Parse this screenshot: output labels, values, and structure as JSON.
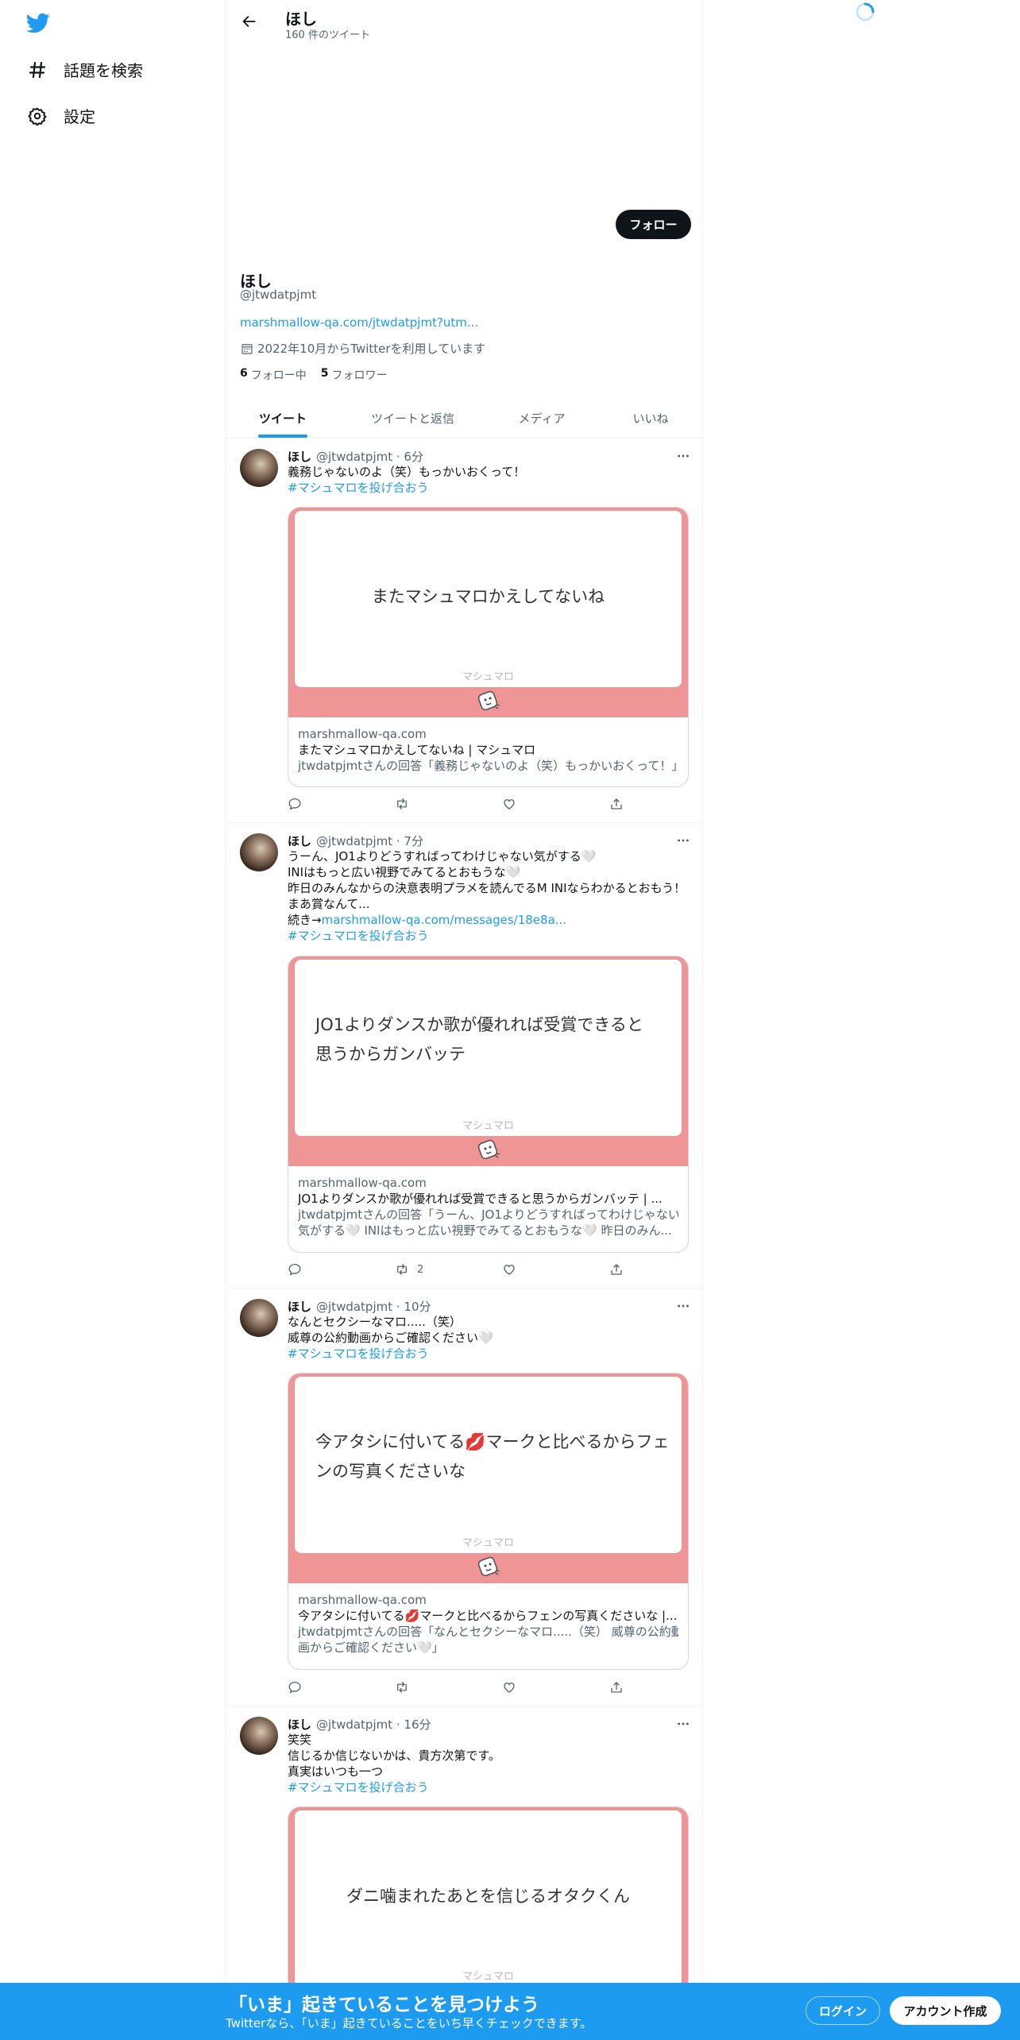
{
  "nav": {
    "items": [
      {
        "label": "話題を検索",
        "icon": "hashtag-icon"
      },
      {
        "label": "設定",
        "icon": "gear-icon"
      }
    ]
  },
  "header": {
    "name": "ほし",
    "tweet_count": "160 件のツイート"
  },
  "profile": {
    "follow_label": "フォロー",
    "name": "ほし",
    "handle": "@jtwdatpjmt",
    "link": "marshmallow-qa.com/jtwdatpjmt?utm...",
    "joined": "2022年10月からTwitterを利用しています",
    "following_count": "6",
    "following_label": "フォロー中",
    "followers_count": "5",
    "followers_label": "フォロワー"
  },
  "tabs": [
    {
      "label": "ツイート",
      "active": true
    },
    {
      "label": "ツイートと返信",
      "active": false
    },
    {
      "label": "メディア",
      "active": false
    },
    {
      "label": "いいね",
      "active": false
    }
  ],
  "tweets": [
    {
      "name": "ほし",
      "meta": "@jtwdatpjmt · 6分",
      "lines": [
        "義務じゃないのよ（笑）もっかいおくって！"
      ],
      "hashtag": "#マシュマロを投げ合おう",
      "card": {
        "question": "またマシュマロかえしてないね",
        "brand": "マシュマロ",
        "domain": "marshmallow-qa.com",
        "title": "またマシュマロかえしてないね | マシュマロ",
        "desc_lines": [
          "jtwdatpjmtさんの回答「義務じゃないのよ（笑）もっかいおくって！」"
        ]
      },
      "retweets": ""
    },
    {
      "name": "ほし",
      "meta": "@jtwdatpjmt · 7分",
      "lines": [
        "うーん、JO1よりどうすればってわけじゃない気がする🤍",
        "INIはもっと広い視野でみてるとおもうな🤍",
        "昨日のみんなからの決意表明プラメを読んでるM INIならわかるとおもう！",
        "まあ賞なんて..."
      ],
      "more_prefix": "続き→",
      "more_link": "marshmallow-qa.com/messages/18e8a...",
      "hashtag": "#マシュマロを投げ合おう",
      "card": {
        "question_lines": [
          "JO1よりダンスか歌が優れれば受賞できると",
          "思うからガンバッテ"
        ],
        "brand": "マシュマロ",
        "domain": "marshmallow-qa.com",
        "title": "JO1よりダンスか歌が優れれば受賞できると思うからガンバッテ | ...",
        "desc_lines": [
          "jtwdatpjmtさんの回答「うーん、JO1よりどうすればってわけじゃない",
          "気がする🤍 INIはもっと広い視野でみてるとおもうな🤍 昨日のみん..."
        ]
      },
      "retweets": "2"
    },
    {
      "name": "ほし",
      "meta": "@jtwdatpjmt · 10分",
      "lines": [
        "なんとセクシーなマロ.....（笑）",
        "威尊の公約動画からご確認ください🤍"
      ],
      "hashtag": "#マシュマロを投げ合おう",
      "card": {
        "question_lines": [
          "今アタシに付いてる💋マークと比べるからフェ",
          "ンの写真くださいな"
        ],
        "brand": "マシュマロ",
        "domain": "marshmallow-qa.com",
        "title": "今アタシに付いてる💋マークと比べるからフェンの写真くださいな |...",
        "desc_lines": [
          "jtwdatpjmtさんの回答「なんとセクシーなマロ.....（笑） 威尊の公約動",
          "画からご確認ください🤍」"
        ]
      },
      "retweets": ""
    },
    {
      "name": "ほし",
      "meta": "@jtwdatpjmt · 16分",
      "lines": [
        "笑笑",
        "信じるか信じないかは、貴方次第です。",
        "真実はいつも一つ"
      ],
      "hashtag": "#マシュマロを投げ合おう",
      "card": {
        "question": "ダニ噛まれたあとを信じるオタクくん",
        "brand": "マシュマロ"
      }
    }
  ],
  "bottom": {
    "title": "「いま」起きていることを見つけよう",
    "subtitle": "Twitterなら、「いま」起きていることをいち早くチェックできます。",
    "login": "ログイン",
    "signup": "アカウント作成"
  }
}
